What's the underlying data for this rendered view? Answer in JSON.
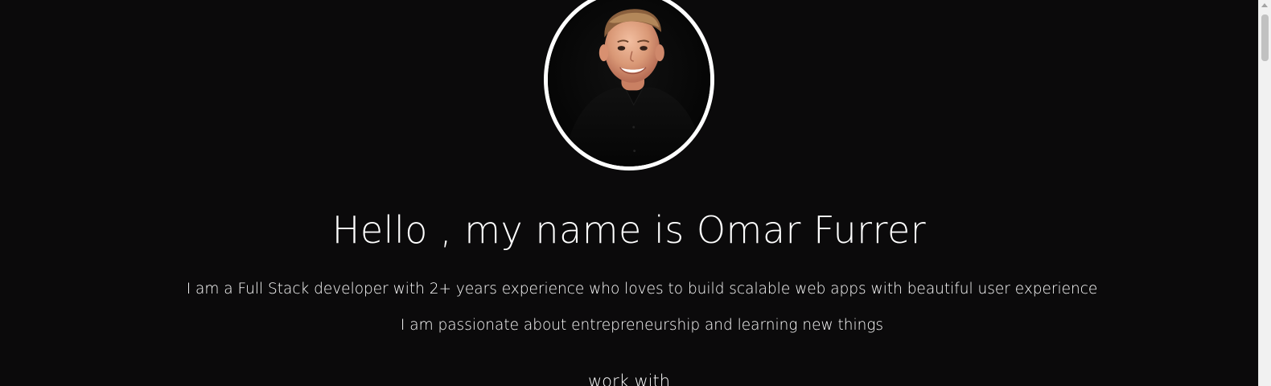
{
  "profile": {
    "photo_alt": "Omar Furrer portrait",
    "headline": "Hello , my name is Omar Furrer",
    "bio_line_1": "I am a Full Stack developer with 2+ years experience who loves to build scalable web apps with beautiful user experience",
    "bio_line_2": "I am passionate about entrepreneurship and learning new things"
  },
  "section": {
    "work_with_heading": "work with"
  },
  "colors": {
    "background": "#0b0a0b",
    "text": "#ffffff",
    "avatar_border": "#ffffff"
  },
  "icons": {
    "avatar": "avatar-photo"
  }
}
